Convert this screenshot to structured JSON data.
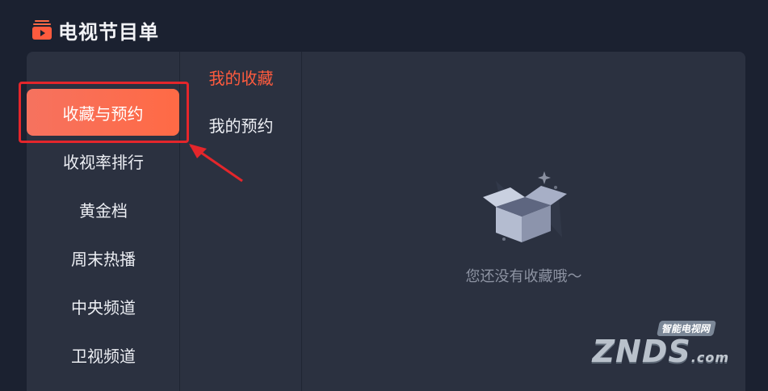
{
  "header": {
    "title": "电视节目单",
    "icon": "tv-icon"
  },
  "categories": [
    {
      "label": "收藏与预约",
      "active": true
    },
    {
      "label": "收视率排行",
      "active": false
    },
    {
      "label": "黄金档",
      "active": false
    },
    {
      "label": "周末热播",
      "active": false
    },
    {
      "label": "中央频道",
      "active": false
    },
    {
      "label": "卫视频道",
      "active": false
    }
  ],
  "subtabs": [
    {
      "label": "我的收藏",
      "active": true
    },
    {
      "label": "我的预约",
      "active": false
    }
  ],
  "empty_state": {
    "message": "您还没有收藏哦～",
    "icon": "empty-box-icon"
  },
  "watermark": {
    "tag": "智能电视网",
    "brand": "ZNDS",
    "suffix": ".com"
  },
  "colors": {
    "accent": "#ff5b3e",
    "highlight_box": "#e4262b",
    "background": "#1b2130",
    "panel": "#2b3140"
  }
}
